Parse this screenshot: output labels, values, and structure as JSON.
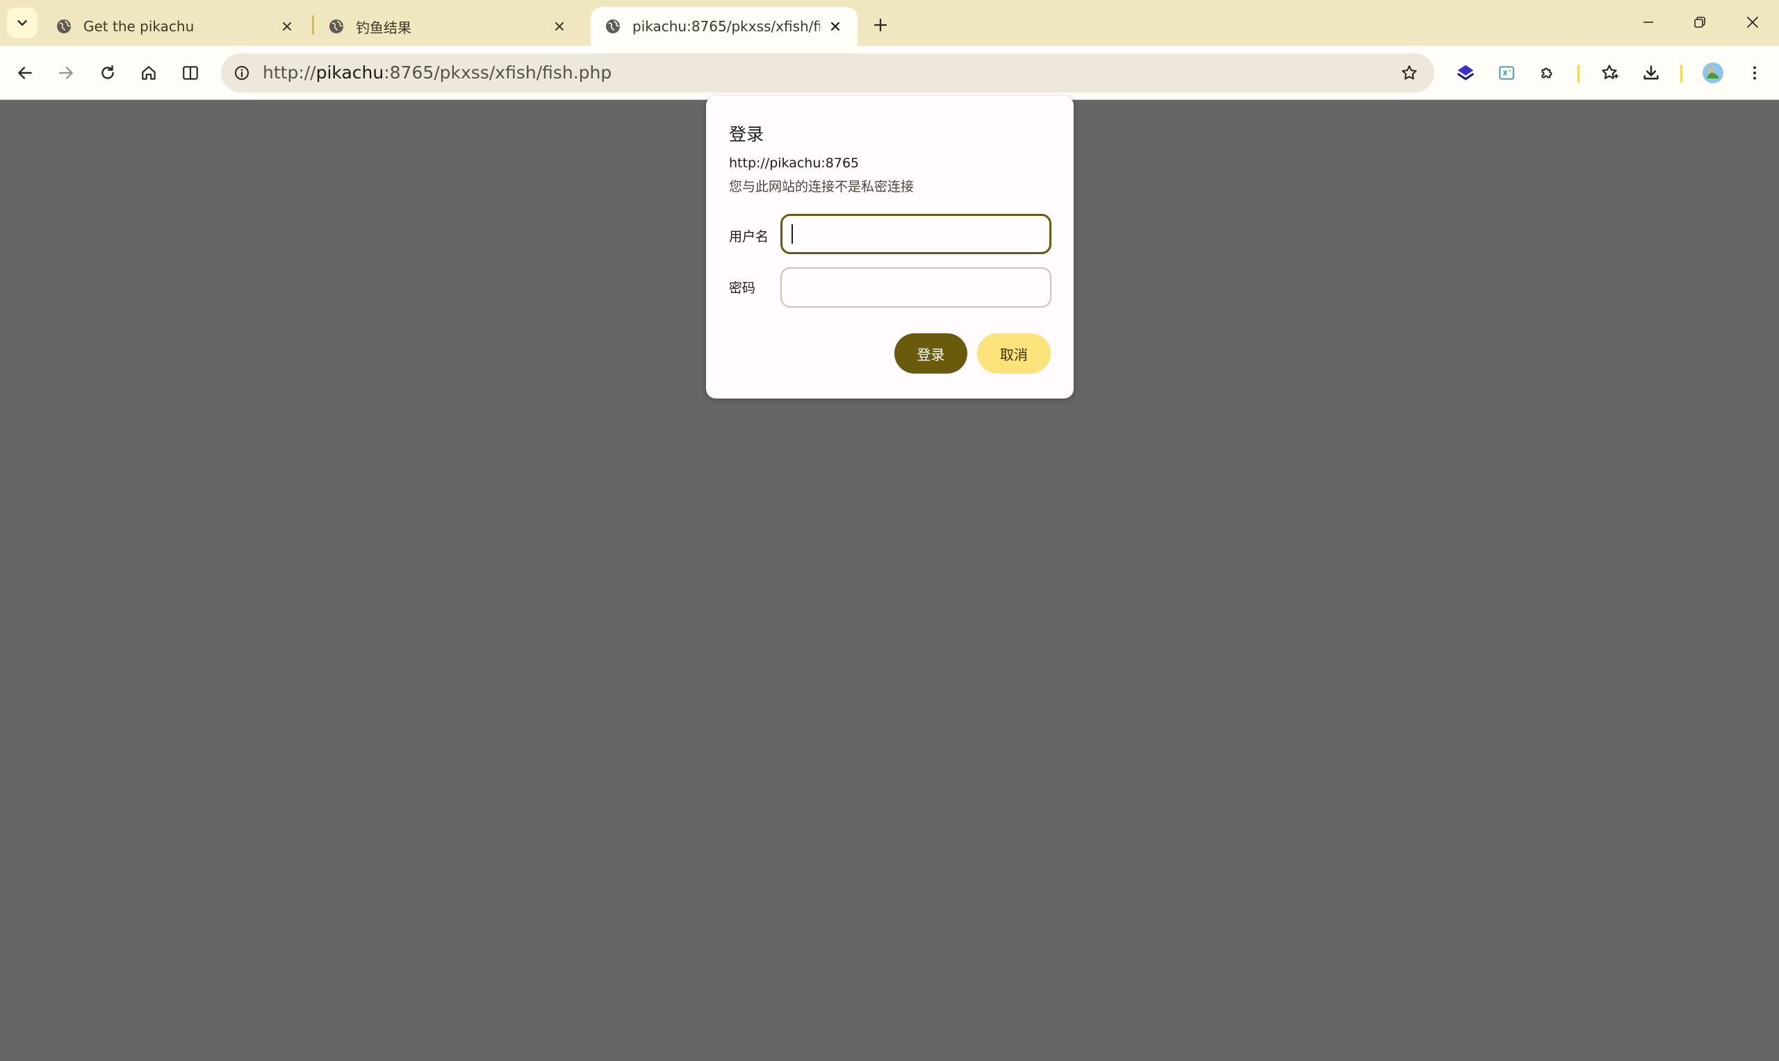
{
  "browser": {
    "tabs": [
      {
        "title": "Get the pikachu",
        "active": false
      },
      {
        "title": "钓鱼结果",
        "active": false
      },
      {
        "title": "pikachu:8765/pkxss/xfish/fish.php",
        "active": true
      }
    ],
    "address_bar": {
      "scheme": "http://",
      "host": "pikachu",
      "rest": ":8765/pkxss/xfish/fish.php"
    },
    "icons": {
      "tab_search": "chevron-down-icon",
      "tab_favicon": "globe-icon",
      "new_tab": "plus-icon",
      "back": "arrow-left-icon",
      "forward": "arrow-right-icon",
      "reload": "reload-icon",
      "home": "home-icon",
      "split": "split-view-icon",
      "site_info": "info-icon",
      "bookmark": "star-icon",
      "ext1": "layers-icon",
      "ext2": "formula-icon",
      "extensions": "puzzle-icon",
      "favorites": "favorites-icon",
      "downloads": "download-icon",
      "profile": "avatar-icon",
      "menu": "kebab-menu-icon"
    },
    "colors": {
      "tabstrip": "#f0e6bf",
      "toolbar": "#fffdf8",
      "accent_divider": "#f2d64b",
      "page_background": "#666666"
    }
  },
  "dialog": {
    "title": "登录",
    "origin": "http://pikachu:8765",
    "warning": "您与此网站的连接不是私密连接",
    "username_label": "用户名",
    "username_value": "",
    "password_label": "密码",
    "password_value": "",
    "login_button": "登录",
    "cancel_button": "取消",
    "colors": {
      "primary": "#6a5a0c",
      "secondary": "#fbe27a"
    }
  }
}
